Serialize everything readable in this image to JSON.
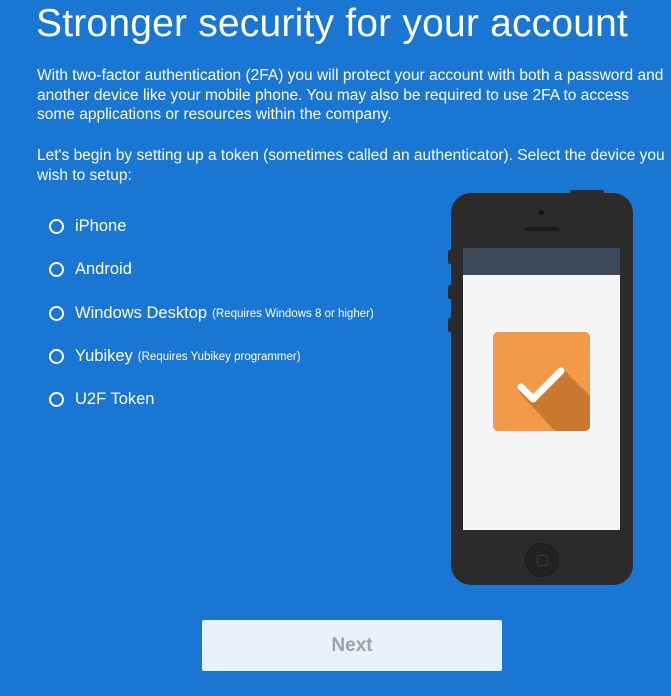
{
  "page": {
    "title": "Stronger security for your account",
    "intro": "With two-factor authentication (2FA) you will protect your account with both a password and another device like your mobile phone. You may also be required to use 2FA to access some applications or resources within the company.",
    "instruction": "Let's begin by setting up a token (sometimes called an authenticator). Select the device you wish to setup:"
  },
  "options": [
    {
      "label": "iPhone",
      "note": "",
      "selected": false
    },
    {
      "label": "Android",
      "note": "",
      "selected": false
    },
    {
      "label": "Windows Desktop",
      "note": "(Requires Windows 8 or higher)",
      "selected": false
    },
    {
      "label": "Yubikey",
      "note": "(Requires Yubikey programmer)",
      "selected": false
    },
    {
      "label": "U2F Token",
      "note": "",
      "selected": false
    }
  ],
  "illustration": {
    "icon": "checkmark-icon",
    "tile_color": "#f2994a",
    "screen_header_color": "#3d4a5a"
  },
  "actions": {
    "next_label": "Next"
  },
  "colors": {
    "background": "#1976d2",
    "button_background": "#e9f1fb",
    "button_text": "#9aa3ad"
  }
}
